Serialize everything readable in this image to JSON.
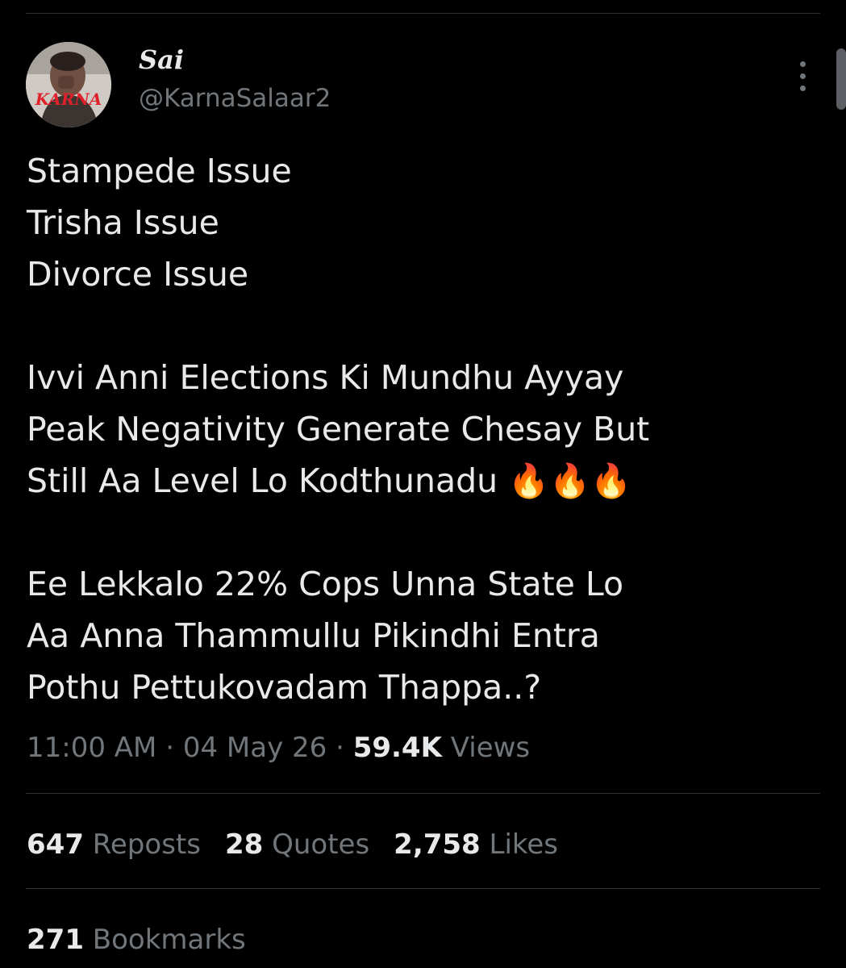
{
  "author": {
    "display_name": "Sai",
    "handle": "@KarnaSalaar2",
    "avatar_logo_text": "KARNA"
  },
  "tweet": {
    "lines": [
      "Stampede Issue",
      "Trisha Issue",
      "Divorce Issue",
      "",
      "Ivvi Anni Elections Ki Mundhu Ayyay",
      "Peak Negativity Generate Chesay But",
      "Still Aa Level Lo Kodthunadu 🔥🔥🔥",
      "",
      "Ee Lekkalo 22% Cops Unna State Lo",
      "Aa Anna Thammullu Pikindhi Entra",
      "Pothu Pettukovadam Thappa..?"
    ]
  },
  "meta": {
    "time": "11:00 AM",
    "separator": " · ",
    "date": "04 May 26",
    "views_count": "59.4K",
    "views_label": " Views"
  },
  "stats": {
    "reposts_count": "647",
    "reposts_label": " Reposts",
    "quotes_count": "28",
    "quotes_label": " Quotes",
    "likes_count": "2,758",
    "likes_label": " Likes",
    "bookmarks_count": "271",
    "bookmarks_label": " Bookmarks"
  },
  "icons": {
    "more": "more-options-icon"
  },
  "colors": {
    "background": "#000000",
    "primary_text": "#e7e9ea",
    "secondary_text": "#71767b",
    "divider": "#2f3336"
  }
}
